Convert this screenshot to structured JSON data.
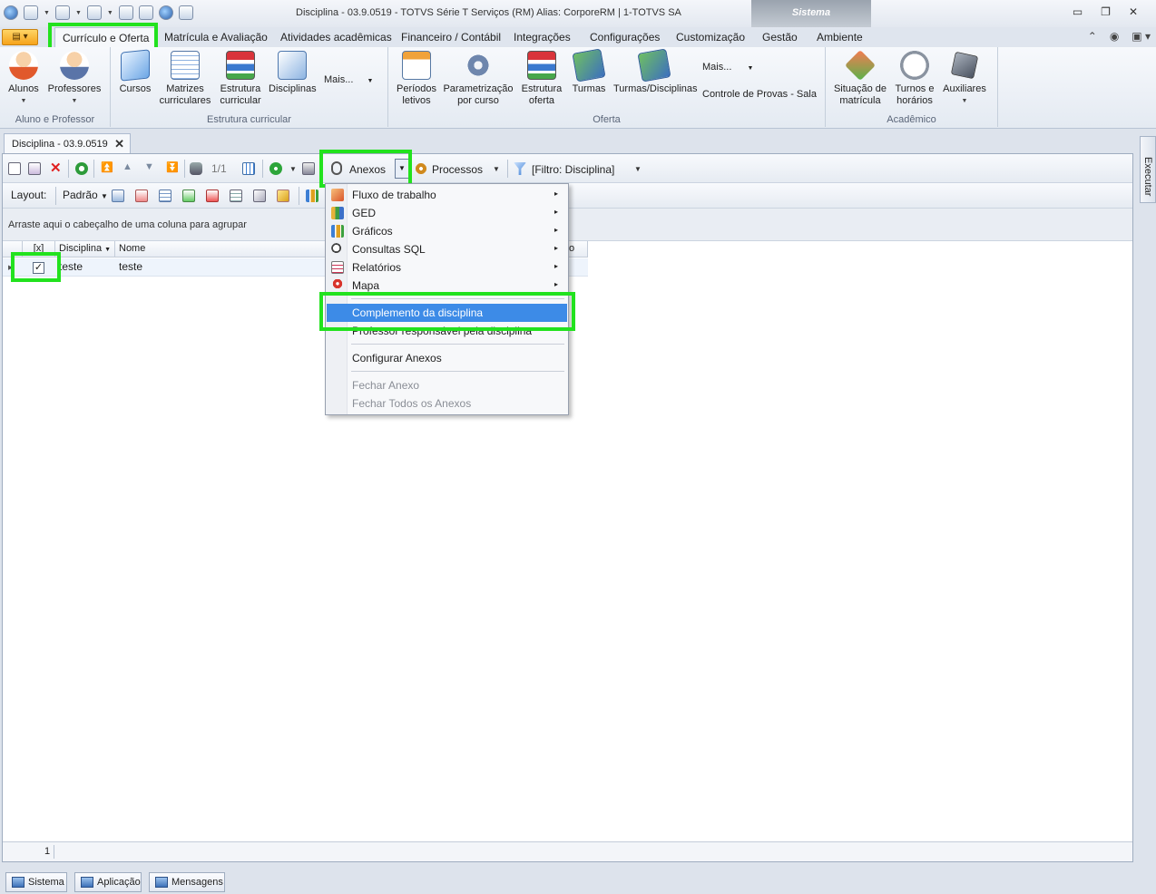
{
  "window": {
    "title": "Disciplina - 03.9.0519 - TOTVS Série T Serviços (RM) Alias: CorporeRM | 1-TOTVS SA",
    "context_tab": "Sistema",
    "controls": {
      "minimize": "▭",
      "restore": "❐",
      "close": "✕"
    }
  },
  "ribbon_tabs": [
    {
      "label": "Currículo e Oferta"
    },
    {
      "label": "Matrícula e Avaliação"
    },
    {
      "label": "Atividades acadêmicas"
    },
    {
      "label": "Financeiro / Contábil"
    },
    {
      "label": "Integrações"
    },
    {
      "label": "Configurações"
    },
    {
      "label": "Customização"
    },
    {
      "label": "Gestão"
    },
    {
      "label": "Ambiente"
    }
  ],
  "ribbon_right": {
    "collapse": "⌃",
    "help": "◉",
    "layout": "▣ ▾"
  },
  "ribbon_groups": {
    "aluno_professor": {
      "label": "Aluno e Professor",
      "alunos": "Alunos",
      "professores": "Professores"
    },
    "estrutura": {
      "label": "Estrutura curricular",
      "cursos": "Cursos",
      "matrizes": "Matrizes curriculares",
      "estrutura": "Estrutura curricular",
      "disciplinas": "Disciplinas",
      "mais": "Mais..."
    },
    "oferta": {
      "label": "Oferta",
      "periodos": "Períodos letivos",
      "parametrizacao": "Parametrização por curso",
      "estrutura_oferta": "Estrutura oferta",
      "turmas": "Turmas",
      "turmas_disciplinas": "Turmas/Disciplinas",
      "mais": "Mais...",
      "controle_provas": "Controle de Provas - Sala"
    },
    "academico": {
      "label": "Acadêmico",
      "situacao": "Situação de matrícula",
      "turnos": "Turnos e horários",
      "auxiliares": "Auxiliares"
    }
  },
  "doc_tab": {
    "label": "Disciplina - 03.9.0519",
    "close": "✕"
  },
  "toolbar": {
    "record_position": "1/1",
    "anexos": "Anexos",
    "processos": "Processos",
    "filtro": "[Filtro: Disciplina]"
  },
  "layout_bar": {
    "label": "Layout:",
    "value": "Padrão"
  },
  "group_area_text": "Arraste aqui o cabeçalho de uma coluna para agrupar",
  "grid": {
    "columns": [
      "[x]",
      "Disciplina",
      "Nome",
      "o"
    ],
    "rows": [
      {
        "checked": "✓",
        "disciplina": "teste",
        "nome": "teste"
      }
    ],
    "footer_count": "1"
  },
  "anexos_menu": {
    "items": [
      {
        "label": "Fluxo de trabalho",
        "icon": "workflow-icon",
        "submenu": "▸"
      },
      {
        "label": "GED",
        "icon": "ged-icon",
        "submenu": "▸"
      },
      {
        "label": "Gráficos",
        "icon": "chart-icon",
        "submenu": "▸"
      },
      {
        "label": "Consultas SQL",
        "icon": "sql-query-icon",
        "submenu": "▸"
      },
      {
        "label": "Relatórios",
        "icon": "report-icon",
        "submenu": "▸"
      },
      {
        "label": "Mapa",
        "icon": "map-pin-icon",
        "submenu": "▸"
      }
    ],
    "complemento": "Complemento da disciplina",
    "professor": "Professor responsável pela disciplina",
    "configurar": "Configurar Anexos",
    "fechar": "Fechar Anexo",
    "fechar_todos": "Fechar Todos os Anexos"
  },
  "side_panel": {
    "executar": "Executar"
  },
  "bottom_tabs": [
    "Sistema",
    "Aplicação",
    "Mensagens"
  ],
  "colors": {
    "highlight": "#22e21e",
    "menu_selected": "#3d8be7",
    "app_menu": "#f6a31b"
  }
}
